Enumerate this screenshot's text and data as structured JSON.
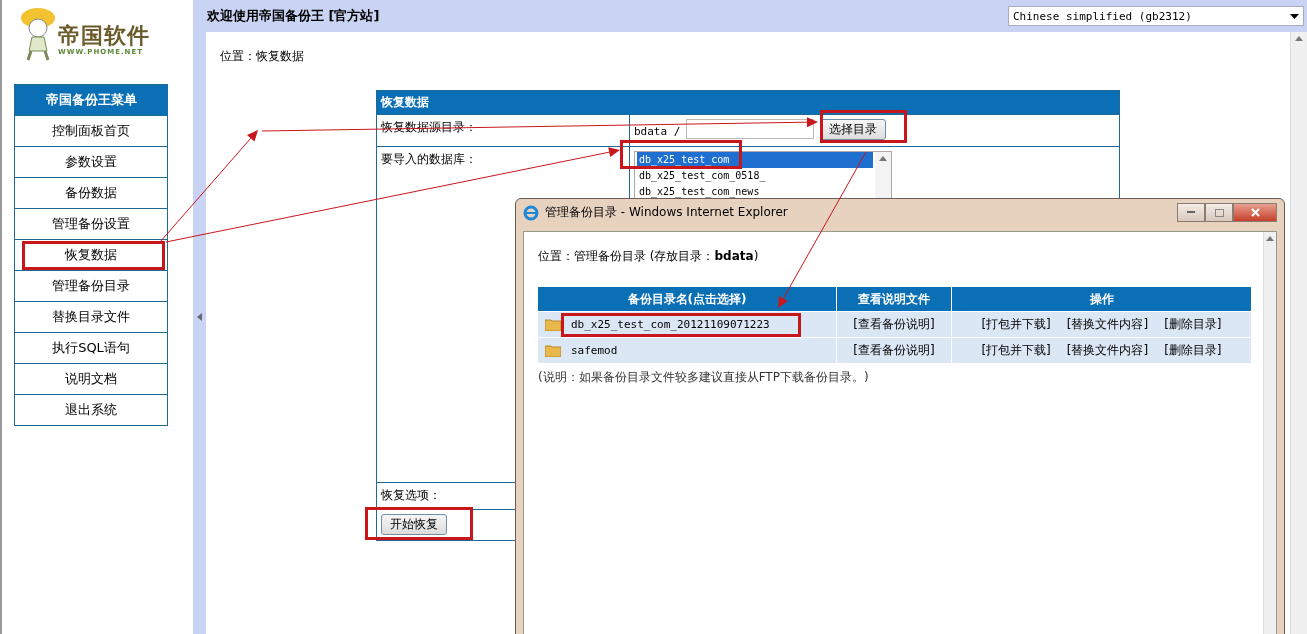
{
  "sidebar": {
    "logo": {
      "name": "帝国软件",
      "url": "WWW.PHOME.NET"
    },
    "menu": {
      "title": "帝国备份王菜单",
      "items": [
        "控制面板首页",
        "参数设置",
        "备份数据",
        "管理备份设置",
        "恢复数据",
        "管理备份目录",
        "替换目录文件",
        "执行SQL语句",
        "说明文档",
        "退出系统"
      ]
    }
  },
  "header": {
    "title": "欢迎使用帝国备份王 [官方站]",
    "language": "Chinese simplified (gb2312)"
  },
  "main": {
    "location": "位置：恢复数据",
    "form": {
      "title": "恢复数据",
      "source_label": "恢复数据源目录：",
      "source_prefix": "bdata /",
      "choose_button": "选择目录",
      "database_label": "要导入的数据库：",
      "databases": [
        {
          "name": "db_x25_test_com",
          "selected": true
        },
        {
          "name": "db_x25_test_com_0518_",
          "selected": false
        },
        {
          "name": "db_x25_test_com_news",
          "selected": false
        }
      ],
      "options_label": "恢复选项：",
      "start_button": "开始恢复"
    }
  },
  "popup": {
    "title": "管理备份目录 - Windows Internet Explorer",
    "location": "位置：管理备份目录 (存放目录：**bdata**)",
    "columns": [
      "备份目录名(点击选择)",
      "查看说明文件",
      "操作"
    ],
    "rows": [
      {
        "name": "db_x25_test_com_20121109071223",
        "view": "[查看备份说明]",
        "actions": [
          "[打包并下载]",
          "[替换文件内容]",
          "[删除目录]"
        ]
      },
      {
        "name": "safemod",
        "view": "[查看备份说明]",
        "actions": [
          "[打包并下载]",
          "[替换文件内容]",
          "[删除目录]"
        ]
      }
    ],
    "note": "(说明：如果备份目录文件较多建议直接从FTP下载备份目录。)"
  }
}
